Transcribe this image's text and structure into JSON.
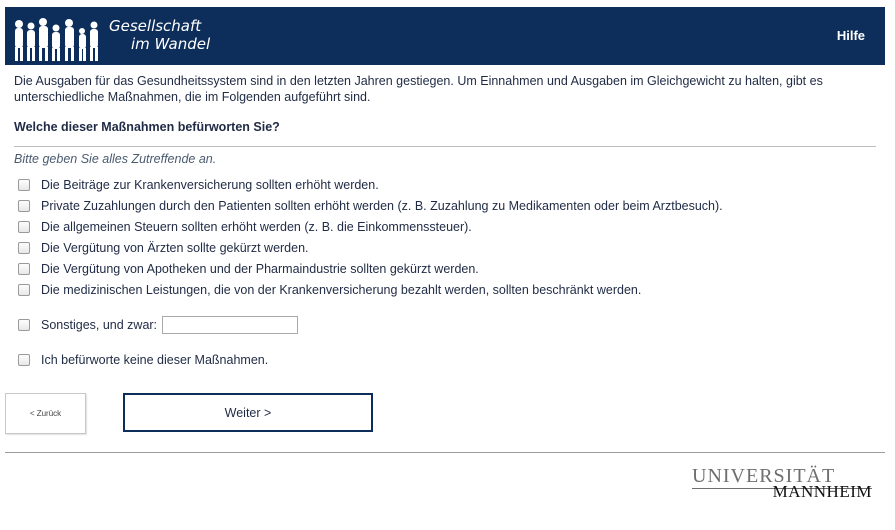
{
  "header": {
    "logo_line1": "Gesellschaft",
    "logo_line2": "im Wandel",
    "help_label": "Hilfe",
    "background_color": "#0d2d5a"
  },
  "survey": {
    "intro": "Die Ausgaben für das Gesundheitssystem sind in den letzten Jahren gestiegen. Um Einnahmen und Ausgaben im Gleichgewicht zu halten, gibt es unterschiedliche Maßnahmen, die im Folgenden aufgeführt sind.",
    "question": "Welche dieser Maßnahmen befürworten Sie?",
    "hint": "Bitte geben Sie alles Zutreffende an.",
    "options": [
      "Die Beiträge zur Krankenversicherung sollten erhöht werden.",
      "Private Zuzahlungen durch den Patienten sollten erhöht werden (z. B. Zuzahlung zu Medikamenten oder beim Arztbesuch).",
      "Die allgemeinen Steuern sollten erhöht werden (z. B. die Einkommenssteuer).",
      "Die Vergütung von Ärzten sollte gekürzt werden.",
      "Die Vergütung von Apotheken und der Pharmaindustrie sollten gekürzt werden.",
      "Die medizinischen Leistungen, die von der Krankenversicherung bezahlt werden, sollten beschränkt werden."
    ],
    "other_label": "Sonstiges, und zwar:",
    "other_value": "",
    "none_label": "Ich befürworte keine dieser Maßnahmen."
  },
  "nav": {
    "back_label": "< Zurück",
    "next_label": "Weiter >"
  },
  "footer": {
    "logo_line1": "UNIVERSITÄT",
    "logo_line2": "MANNHEIM"
  }
}
